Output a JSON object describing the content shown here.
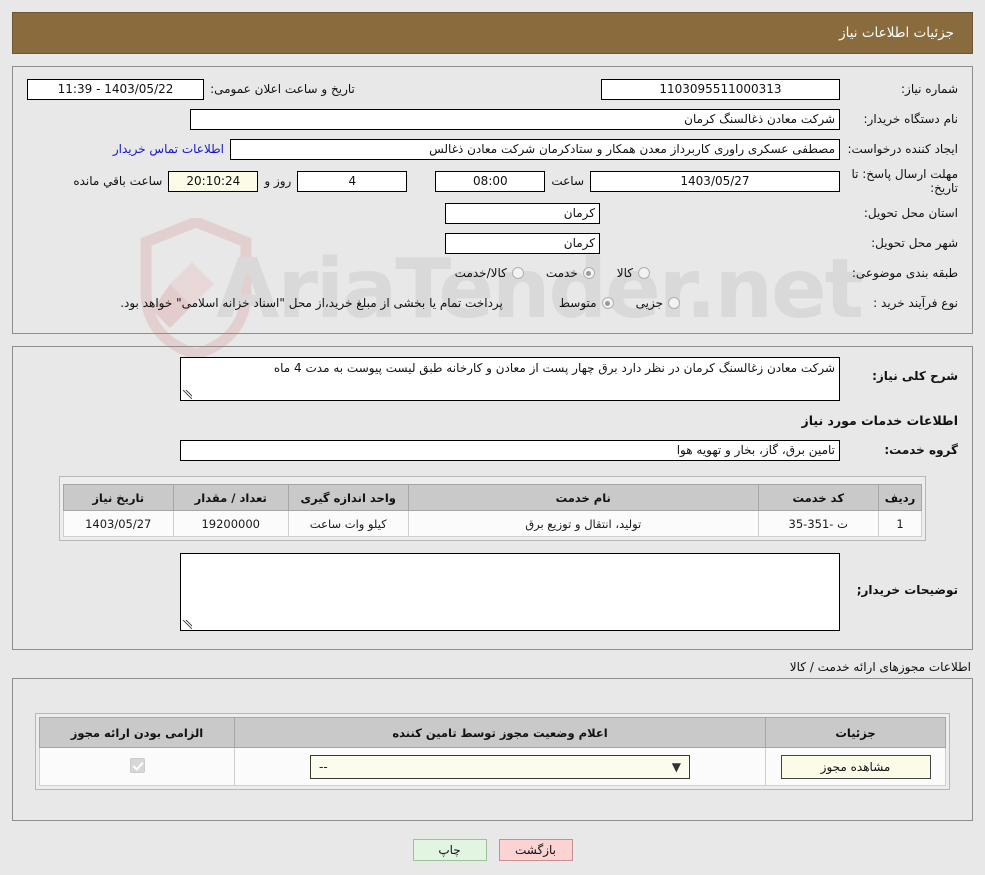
{
  "header": {
    "title": "جزئیات اطلاعات نیاز"
  },
  "form": {
    "need_number_label": "شماره نیاز:",
    "need_number_value": "1103095511000313",
    "public_announce_label": "تاریخ و ساعت اعلان عمومی:",
    "public_announce_value": "1403/05/22 - 11:39",
    "buyer_org_label": "نام دستگاه خریدار:",
    "buyer_org_value": "شرکت معادن ذغالسنگ کرمان",
    "requester_label": "ایجاد کننده درخواست:",
    "requester_value": "مصطفی عسکری راوری کاربرداز معدن همکار و ستادکرمان شرکت معادن ذغالس",
    "contact_link": "اطلاعات تماس خریدار",
    "deadline_label": "مهلت ارسال پاسخ: تا تاریخ:",
    "deadline_date": "1403/05/27",
    "hour_label": "ساعت",
    "deadline_time": "08:00",
    "days_remaining": "4",
    "days_label": "روز و",
    "countdown": "20:10:24",
    "remaining_label": "ساعت باقي مانده",
    "province_label": "استان محل تحویل:",
    "province_value": "کرمان",
    "city_label": "شهر محل تحویل:",
    "city_value": "کرمان",
    "category_label": "طبقه بندی موضوعی:",
    "category_options": [
      {
        "label": "کالا",
        "selected": false
      },
      {
        "label": "خدمت",
        "selected": true
      },
      {
        "label": "کالا/خدمت",
        "selected": false
      }
    ],
    "process_label": "نوع فرآیند خرید :",
    "process_options": [
      {
        "label": "جزیی",
        "selected": false
      },
      {
        "label": "متوسط",
        "selected": true
      }
    ],
    "process_note": "پرداخت تمام یا بخشی از مبلغ خرید،از محل \"اسناد خزانه اسلامی\" خواهد بود."
  },
  "description": {
    "label": "شرح کلی نیاز:",
    "value": "شرکت معادن زغالسنگ کرمان  در نظر دارد برق چهار پست از معادن و کارخانه  طبق لیست پیوست به مدت 4 ماه"
  },
  "services_section": {
    "title": "اطلاعات خدمات مورد نیاز",
    "group_label": "گروه خدمت:",
    "group_value": "تامین برق، گاز، بخار و تهویه هوا"
  },
  "services_table": {
    "columns": [
      "ردیف",
      "کد خدمت",
      "نام خدمت",
      "واحد اندازه گیری",
      "تعداد / مقدار",
      "تاریخ نیاز"
    ],
    "rows": [
      {
        "row_no": "1",
        "service_code": "ت -351-35",
        "service_name": "تولید، انتقال و توزیع برق",
        "unit": "کیلو وات ساعت",
        "quantity": "19200000",
        "need_date": "1403/05/27"
      }
    ]
  },
  "buyer_notes": {
    "label": "توضیحات خریدار;",
    "value": ""
  },
  "permits_section": {
    "caption": "اطلاعات مجوزهای ارائه خدمت / کالا",
    "columns": [
      "الزامی بودن ارائه مجوز",
      "اعلام وضعیت مجوز توسط تامین کننده",
      "جزئیات"
    ],
    "rows": [
      {
        "required_checked": true,
        "status_value": "--",
        "details_button": "مشاهده مجوز"
      }
    ]
  },
  "footer": {
    "back_label": "بازگشت",
    "print_label": "چاپ"
  },
  "watermark": {
    "text": "AriaTender.net"
  },
  "colors": {
    "header_bg": "#8a6b3e",
    "page_bg": "#e8e8e8",
    "link": "#1515d0",
    "back_btn": "#fbd3d3",
    "print_btn": "#e2f5e2",
    "cream": "#fbfbe8"
  }
}
